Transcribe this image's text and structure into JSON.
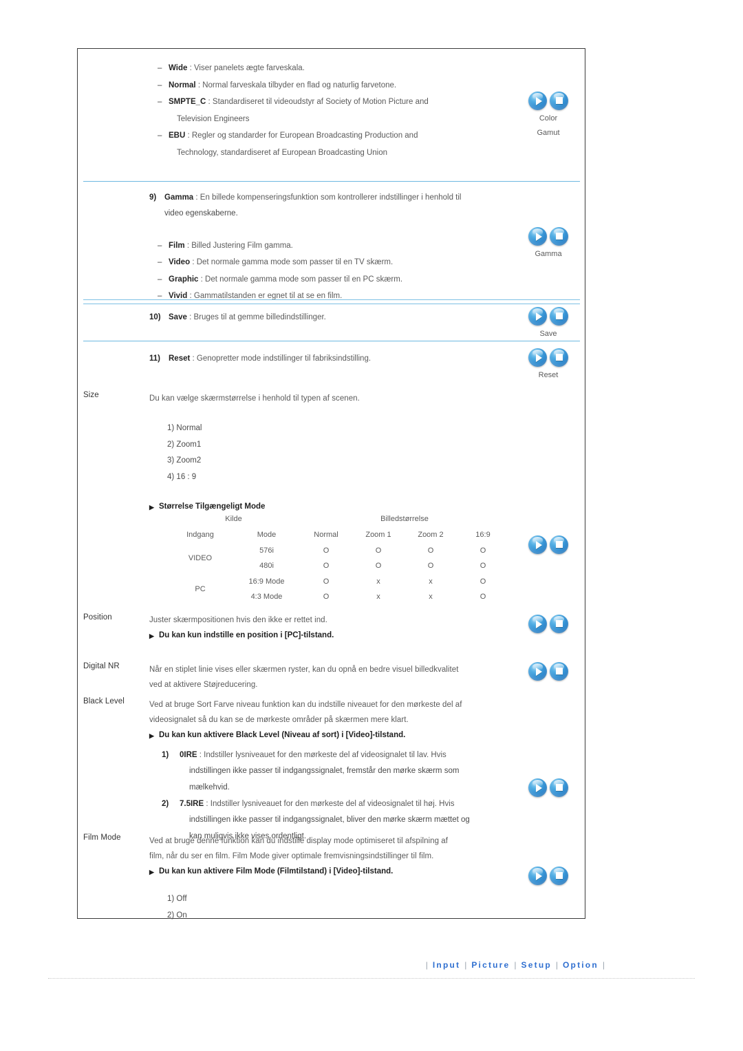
{
  "color_gamut": {
    "items": [
      {
        "term": "Wide",
        "desc": ": Viser panelets ægte farveskala."
      },
      {
        "term": "Normal",
        "desc": ": Normal farveskala tilbyder en flad og naturlig farvetone."
      },
      {
        "term": "SMPTE_C",
        "desc": ": Standardiseret til videoudstyr af Society of Motion Picture and",
        "desc2": "Television Engineers"
      },
      {
        "term": "EBU",
        "desc": ": Regler og standarder for European Broadcasting Production and",
        "desc2": "Technology, standardiseret af European Broadcasting Union"
      }
    ],
    "icon_caption_line1": "Color",
    "icon_caption_line2": "Gamut"
  },
  "gamma": {
    "number": "9)",
    "term": "Gamma",
    "desc_line1": ": En billede kompenseringsfunktion som kontrollerer indstillinger i henhold til",
    "desc_line2": "video egenskaberne.",
    "items": [
      {
        "term": "Film",
        "desc": ": Billed Justering Film gamma."
      },
      {
        "term": "Video",
        "desc": ": Det normale gamma mode som passer til en TV skærm."
      },
      {
        "term": "Graphic",
        "desc": ": Det normale gamma mode som passer til en PC skærm."
      },
      {
        "term": "Vivid",
        "desc": ": Gammatilstanden er egnet til at se en film."
      }
    ],
    "icon_caption": "Gamma"
  },
  "save": {
    "number": "10)",
    "term": "Save",
    "desc": ": Bruges til at gemme billedindstillinger.",
    "icon_caption": "Save"
  },
  "reset": {
    "number": "11)",
    "term": "Reset",
    "desc": ": Genopretter mode indstillinger til fabriksindstilling.",
    "icon_caption": "Reset"
  },
  "size": {
    "label": "Size",
    "intro": "Du kan vælge skærmstørrelse i henhold til typen af scenen.",
    "options": [
      "1) Normal",
      "2) Zoom1",
      "3) Zoom2",
      "4) 16 : 9"
    ],
    "note": "Størrelse Tilgængeligt Mode",
    "table": {
      "group_headers": [
        "Kilde",
        "Billedstørrelse"
      ],
      "columns": [
        "Indgang",
        "Mode",
        "Normal",
        "Zoom 1",
        "Zoom 2",
        "16:9"
      ],
      "rows": [
        {
          "input": "VIDEO",
          "mode": "576i",
          "values": [
            "O",
            "O",
            "O",
            "O"
          ]
        },
        {
          "input": "",
          "mode": "480i",
          "values": [
            "O",
            "O",
            "O",
            "O"
          ]
        },
        {
          "input": "PC",
          "mode": "16:9 Mode",
          "values": [
            "O",
            "x",
            "x",
            "O"
          ]
        },
        {
          "input": "",
          "mode": "4:3 Mode",
          "values": [
            "O",
            "x",
            "x",
            "O"
          ]
        }
      ]
    }
  },
  "position": {
    "label": "Position",
    "desc": "Juster skærmpositionen hvis den ikke er rettet ind.",
    "note": "Du kan kun indstille en position i [PC]-tilstand."
  },
  "digital_nr": {
    "label": "Digital NR",
    "desc_line1": "Når en stiplet linie vises eller skærmen ryster, kan du opnå en bedre visuel billedkvalitet",
    "desc_line2": "ved at aktivere Støjreducering."
  },
  "black_level": {
    "label": "Black Level",
    "desc_line1": "Ved at bruge Sort Farve niveau funktion kan du indstille niveauet for den mørkeste del af",
    "desc_line2": "videosignalet så du kan se de mørkeste områder på skærmen mere klart.",
    "note": "Du kan kun aktivere Black Level (Niveau af sort) i [Video]-tilstand.",
    "items": [
      {
        "num": "1)",
        "term": "0IRE",
        "line1": ": Indstiller lysniveauet for den mørkeste del af videosignalet til lav. Hvis",
        "line2": "indstillingen ikke passer til indgangssignalet, fremstår den mørke skærm som",
        "line3": "mælkehvid."
      },
      {
        "num": "2)",
        "term": "7.5IRE",
        "line1": ": Indstiller lysniveauet for den mørkeste del af videosignalet til høj. Hvis",
        "line2": "indstillingen ikke passer til indgangssignalet, bliver den mørke skærm mættet og",
        "line3": "kan muligvis ikke vises ordentligt."
      }
    ]
  },
  "film_mode": {
    "label": "Film Mode",
    "desc_line1": "Ved at bruge denne funktion kan du indstille display mode optimiseret til afspilning af",
    "desc_line2": "film, når du ser en film. Film Mode giver optimale fremvisningsindstillinger til film.",
    "note": "Du kan kun aktivere Film Mode (Filmtilstand) i [Video]-tilstand.",
    "options": [
      "1) Off",
      "2) On"
    ]
  },
  "footer": {
    "separator": "|",
    "links": [
      "Input",
      "Picture",
      "Setup",
      "Option"
    ]
  },
  "icons": {
    "play": "play-icon",
    "stop": "stop-icon",
    "triangle_bullet": "▶"
  },
  "colors": {
    "divider_blue": "#6cb8e0",
    "link_blue": "#2f6fd0",
    "frame_border": "#3a3a3a"
  }
}
